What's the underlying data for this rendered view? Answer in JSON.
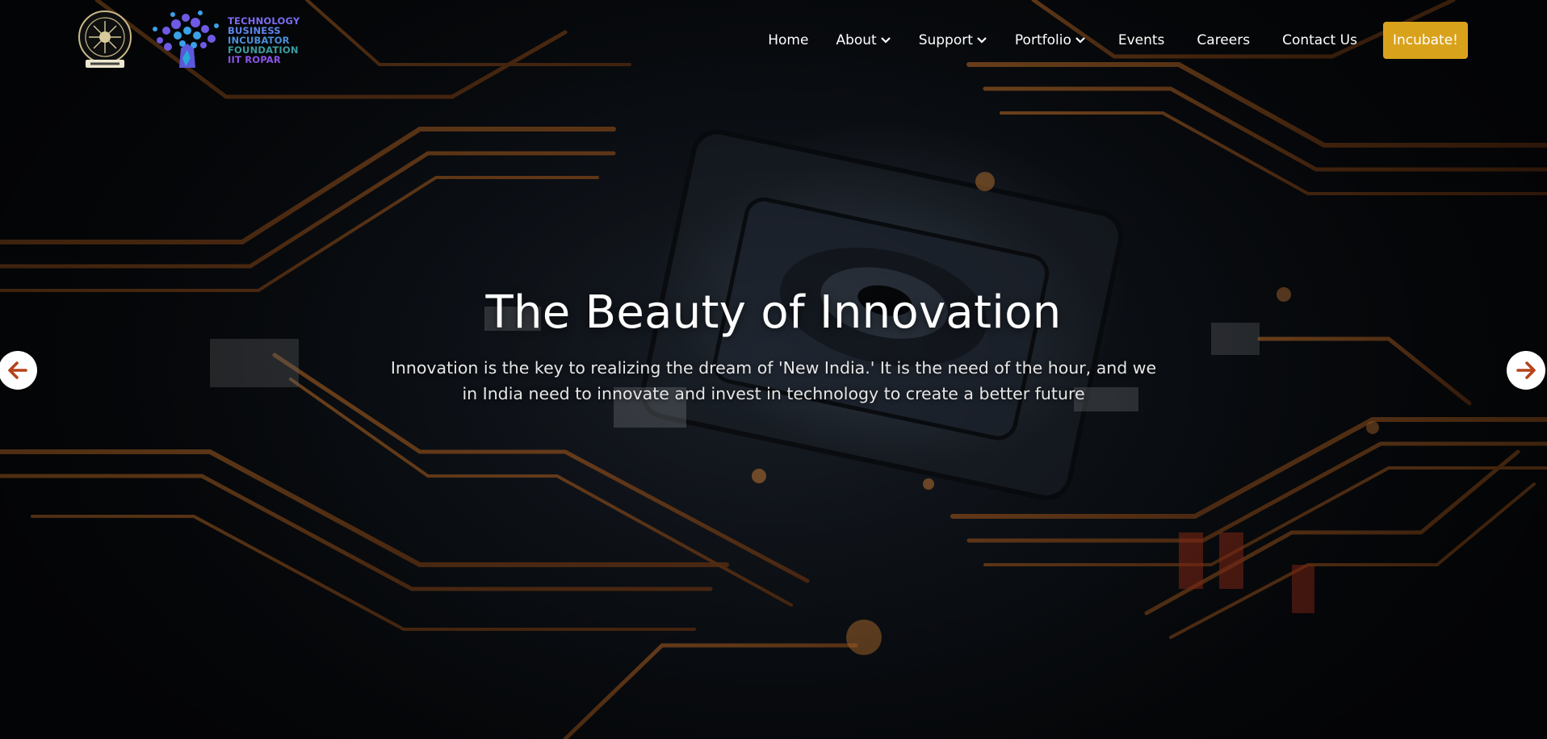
{
  "brand": {
    "tbif_lines": [
      "TECHNOLOGY",
      "BUSINESS",
      "INCUBATOR",
      "FOUNDATION",
      "IIT ROPAR"
    ]
  },
  "nav": {
    "items": [
      {
        "label": "Home",
        "dropdown": false
      },
      {
        "label": "About",
        "dropdown": true
      },
      {
        "label": "Support",
        "dropdown": true
      },
      {
        "label": "Portfolio",
        "dropdown": true
      },
      {
        "label": "Events",
        "dropdown": false
      },
      {
        "label": "Careers",
        "dropdown": false
      },
      {
        "label": "Contact Us",
        "dropdown": false
      }
    ],
    "cta_label": "Incubate!"
  },
  "slide": {
    "title": "The Beauty of Innovation",
    "subtitle": "Innovation is the key to realizing the dream of 'New India.' It is the need of the hour, and we in India need to innovate and invest in technology to create a better future"
  },
  "carousel": {
    "prev_icon": "arrow-left-icon",
    "next_icon": "arrow-right-icon"
  },
  "colors": {
    "accent": "#d9a21b",
    "arrow_icon": "#b5421a",
    "background": "#0d1117"
  }
}
